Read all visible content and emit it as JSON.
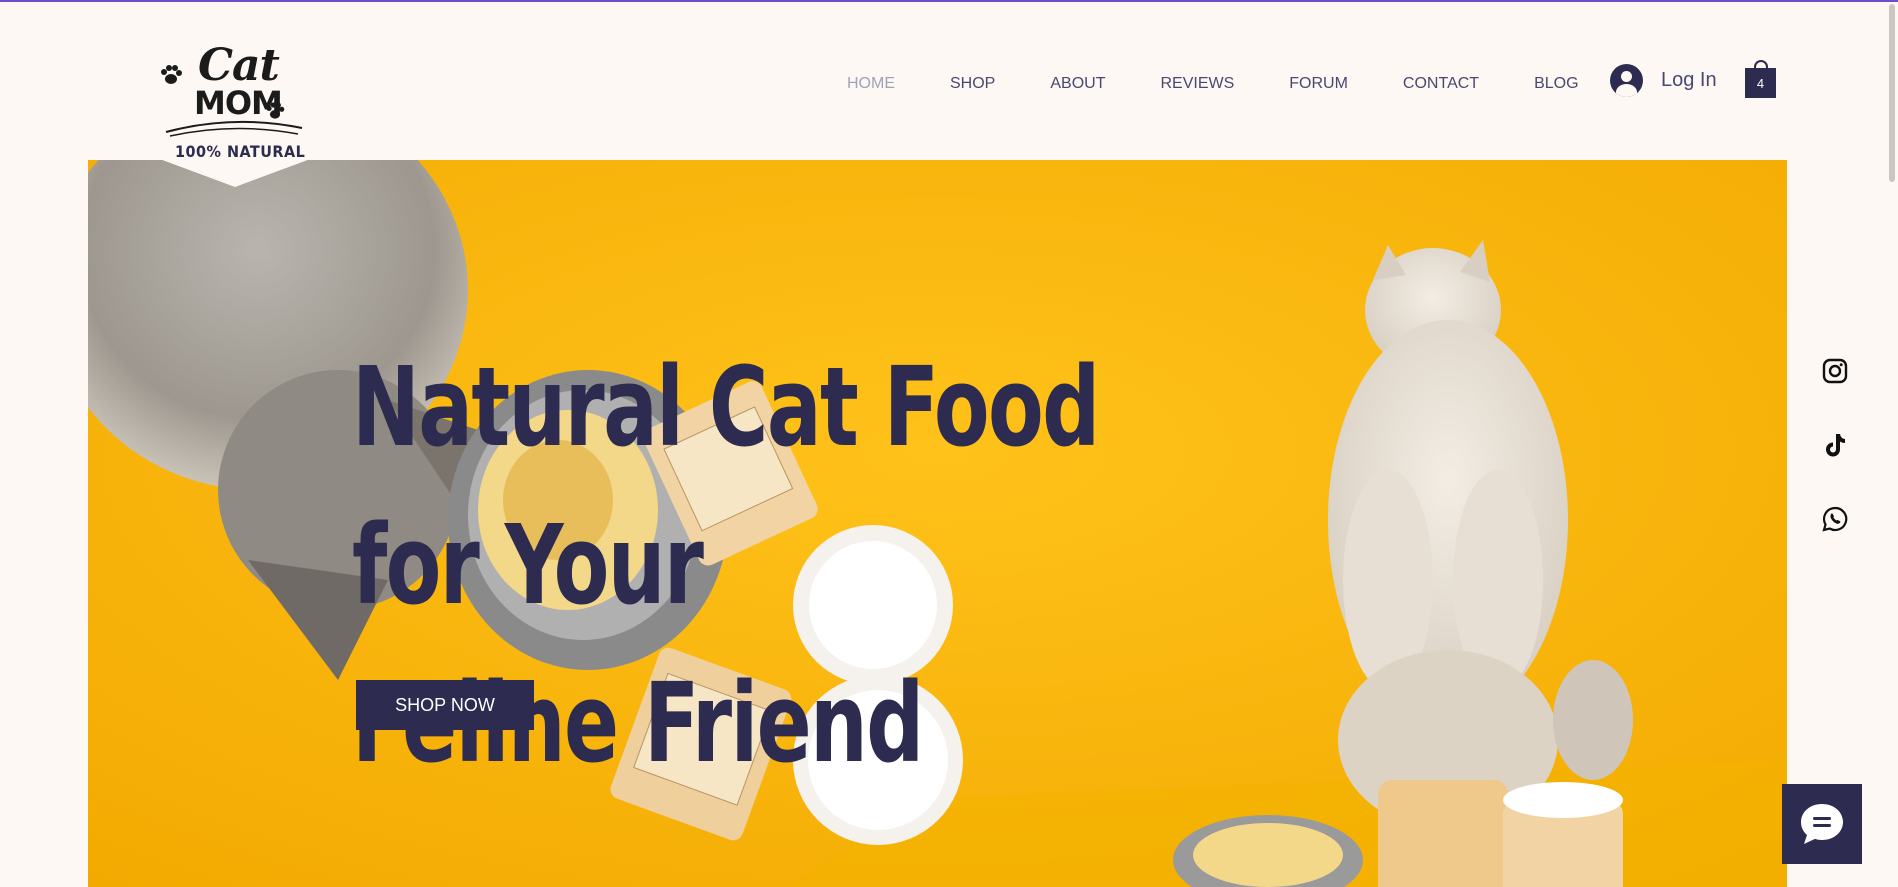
{
  "brand": {
    "logo_line1": "Cat",
    "logo_line2": "MOM",
    "logo_tagline": "100% NATURAL"
  },
  "nav": {
    "items": [
      {
        "label": "HOME",
        "active": true
      },
      {
        "label": "SHOP",
        "active": false
      },
      {
        "label": "ABOUT",
        "active": false
      },
      {
        "label": "REVIEWS",
        "active": false
      },
      {
        "label": "FORUM",
        "active": false
      },
      {
        "label": "CONTACT",
        "active": false
      },
      {
        "label": "BLOG",
        "active": false
      }
    ],
    "login_label": "Log In",
    "cart_count": "4"
  },
  "hero": {
    "title_line1": "Natural Cat Food for Your",
    "title_line2": "Feline Friend",
    "cta_label": "SHOP NOW"
  },
  "social": {
    "icons": [
      "instagram-icon",
      "tiktok-icon",
      "whatsapp-icon"
    ]
  },
  "chat": {
    "icon": "chat-bubble-icon"
  },
  "colors": {
    "page_bg": "#fdf8f4",
    "brand_dark": "#2d2b4f",
    "hero_yellow": "#f7b500",
    "nav_text": "#4a4870",
    "nav_active": "#a3a1b8"
  }
}
